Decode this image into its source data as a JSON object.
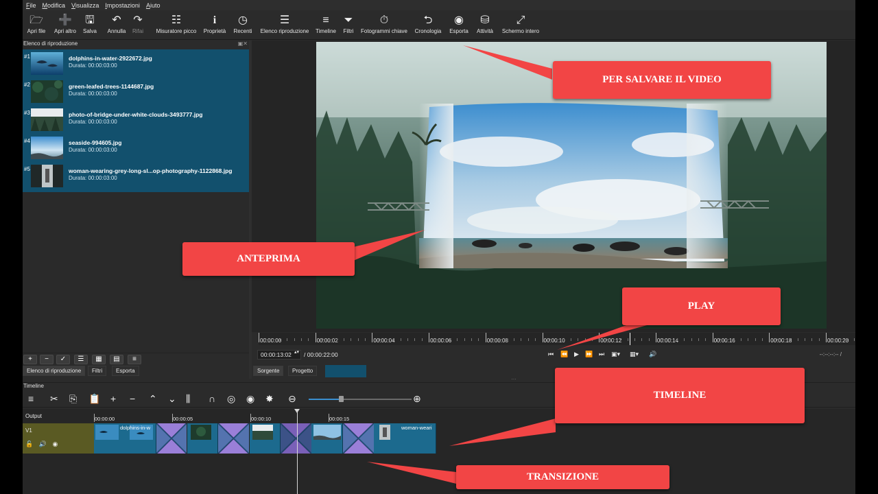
{
  "menu": [
    "File",
    "Modifica",
    "Visualizza",
    "Impostazioni",
    "Aiuto"
  ],
  "toolbar": {
    "open_file": "Apri file",
    "open_other": "Apri altro",
    "save": "Salva",
    "undo": "Annulla",
    "redo": "Rifai",
    "peak_meter": "Misuratore picco",
    "properties": "Proprietà",
    "recent": "Recenti",
    "playlist": "Elenco riproduzione",
    "timeline": "Timeline",
    "filters": "Filtri",
    "keyframes": "Fotogrammi chiave",
    "history": "Cronologia",
    "export": "Esporta",
    "jobs": "Attività",
    "fullscreen": "Schermo intero"
  },
  "playlist": {
    "title": "Elenco di riproduzione",
    "items": [
      {
        "num": "#1",
        "name": "dolphins-in-water-2922672.jpg",
        "duration": "Durata: 00:00:03:00"
      },
      {
        "num": "#2",
        "name": "green-leafed-trees-1144687.jpg",
        "duration": "Durata: 00:00:03:00"
      },
      {
        "num": "#3",
        "name": "photo-of-bridge-under-white-clouds-3493777.jpg",
        "duration": "Durata: 00:00:03:00"
      },
      {
        "num": "#4",
        "name": "seaside-994605.jpg",
        "duration": "Durata: 00:00:03:00"
      },
      {
        "num": "#5",
        "name": "woman-wearing-grey-long-sl...op-photography-1122868.jpg",
        "duration": "Durata: 00:00:03:00"
      }
    ],
    "tabs": [
      "Elenco di riproduzione",
      "Filtri",
      "Esporta"
    ]
  },
  "viewer": {
    "ruler_labels": [
      "00:00:00",
      "00:00:02",
      "00:00:04",
      "00:00:06",
      "00:00:08",
      "00:00:10",
      "00:00:12",
      "00:00:14",
      "00:00:16",
      "00:00:18",
      "00:00:20"
    ],
    "current_time": "00:00:13:02",
    "total_time": "/ 00:00:22:00",
    "right_time": "--:--:--:-- /",
    "tabs": [
      "Sorgente",
      "Progetto"
    ]
  },
  "timeline": {
    "title": "Timeline",
    "output_label": "Output",
    "track_label": "V1",
    "ruler_labels": [
      "00:00:00",
      "00:00:05",
      "00:00:10",
      "00:00:15"
    ],
    "clip_names": [
      "dolphins-in-w",
      "woman-weari"
    ]
  },
  "callouts": {
    "save": "PER SALVARE IL VIDEO",
    "preview": "ANTEPRIMA",
    "play": "PLAY",
    "timeline": "TIMELINE",
    "transition": "TRANSIZIONE"
  },
  "colors": {
    "callout": "#f24545",
    "playlist_selected": "#12506d",
    "clip": "#1c6a8e",
    "transition": "#9a7fd8",
    "track_head": "#5a5a23"
  }
}
